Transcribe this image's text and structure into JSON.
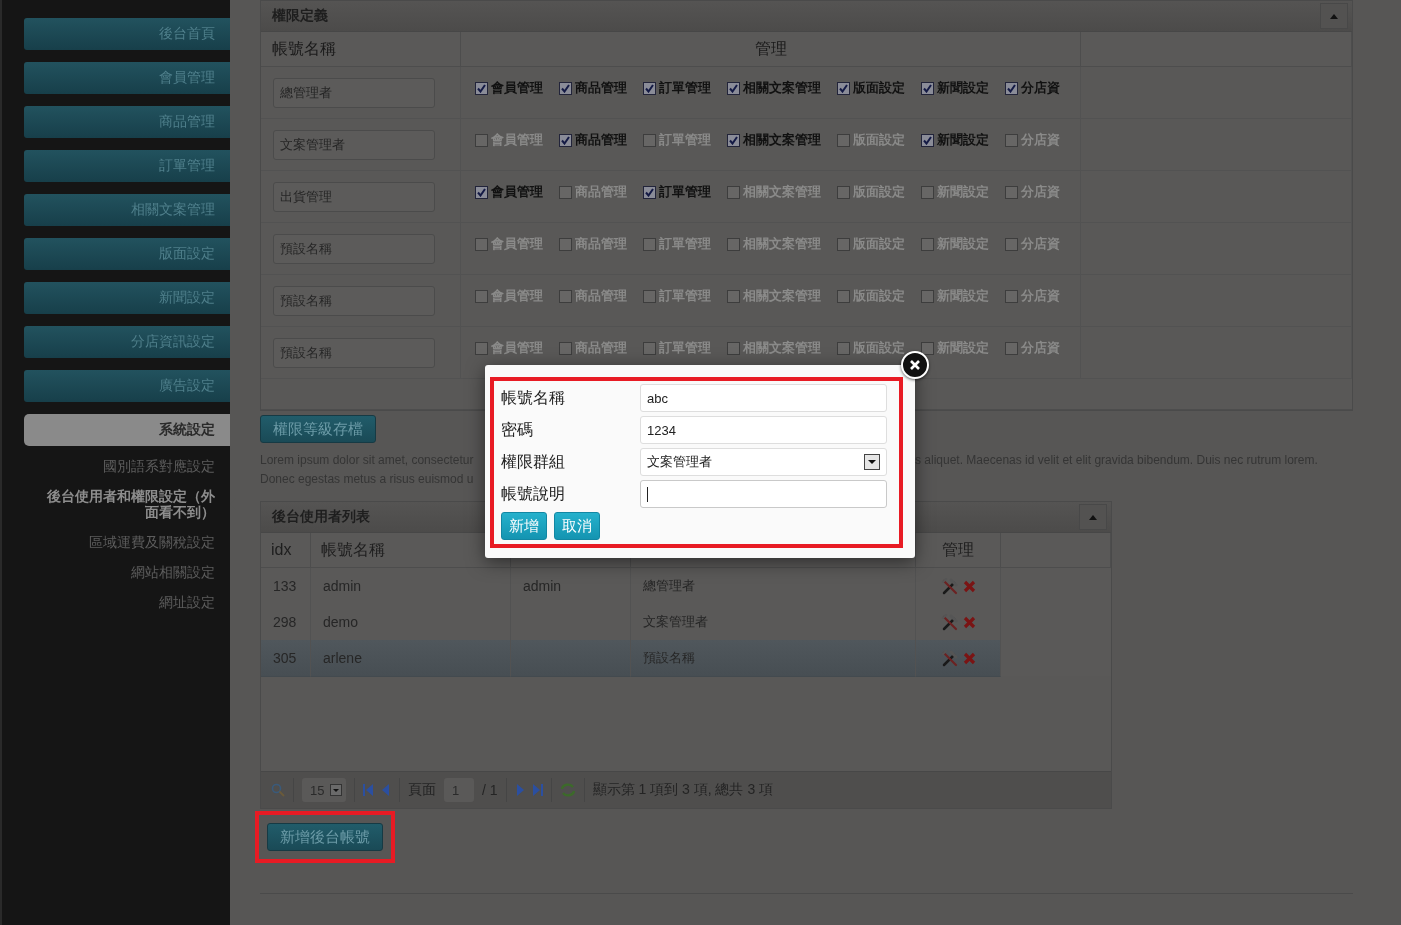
{
  "sidebar": {
    "items": [
      {
        "label": "後台首頁",
        "selected": false
      },
      {
        "label": "會員管理",
        "selected": false
      },
      {
        "label": "商品管理",
        "selected": false
      },
      {
        "label": "訂單管理",
        "selected": false
      },
      {
        "label": "相關文案管理",
        "selected": false
      },
      {
        "label": "版面設定",
        "selected": false
      },
      {
        "label": "新聞設定",
        "selected": false
      },
      {
        "label": "分店資訊設定",
        "selected": false
      },
      {
        "label": "廣告設定",
        "selected": false
      },
      {
        "label": "系統設定",
        "selected": true,
        "children": [
          {
            "label": "國別語系對應設定",
            "selected": false
          },
          {
            "label": "後台使用者和權限設定（外面看不到）",
            "selected": true
          },
          {
            "label": "區域運費及關稅設定",
            "selected": false
          },
          {
            "label": "網站相關設定",
            "selected": false
          },
          {
            "label": "網址設定",
            "selected": false
          }
        ]
      }
    ]
  },
  "permissions": {
    "title": "權限定義",
    "columns": {
      "name": "帳號名稱",
      "manage": "管理"
    },
    "rows": [
      {
        "name": "總管理者",
        "perms": [
          {
            "label": "會員管理",
            "checked": true
          },
          {
            "label": "商品管理",
            "checked": true
          },
          {
            "label": "訂單管理",
            "checked": true
          },
          {
            "label": "相關文案管理",
            "checked": true
          },
          {
            "label": "版面設定",
            "checked": true
          },
          {
            "label": "新聞設定",
            "checked": true
          },
          {
            "label": "分店資",
            "checked": true
          }
        ]
      },
      {
        "name": "文案管理者",
        "perms": [
          {
            "label": "會員管理",
            "checked": false
          },
          {
            "label": "商品管理",
            "checked": true
          },
          {
            "label": "訂單管理",
            "checked": false
          },
          {
            "label": "相關文案管理",
            "checked": true
          },
          {
            "label": "版面設定",
            "checked": false
          },
          {
            "label": "新聞設定",
            "checked": true
          },
          {
            "label": "分店資",
            "checked": false
          }
        ]
      },
      {
        "name": "出貨管理",
        "perms": [
          {
            "label": "會員管理",
            "checked": true
          },
          {
            "label": "商品管理",
            "checked": false
          },
          {
            "label": "訂單管理",
            "checked": true
          },
          {
            "label": "相關文案管理",
            "checked": false
          },
          {
            "label": "版面設定",
            "checked": false
          },
          {
            "label": "新聞設定",
            "checked": false
          },
          {
            "label": "分店資",
            "checked": false
          }
        ]
      },
      {
        "name": "預設名稱",
        "perms": [
          {
            "label": "會員管理",
            "checked": false
          },
          {
            "label": "商品管理",
            "checked": false
          },
          {
            "label": "訂單管理",
            "checked": false
          },
          {
            "label": "相關文案管理",
            "checked": false
          },
          {
            "label": "版面設定",
            "checked": false
          },
          {
            "label": "新聞設定",
            "checked": false
          },
          {
            "label": "分店資",
            "checked": false
          }
        ]
      },
      {
        "name": "預設名稱",
        "perms": [
          {
            "label": "會員管理",
            "checked": false
          },
          {
            "label": "商品管理",
            "checked": false
          },
          {
            "label": "訂單管理",
            "checked": false
          },
          {
            "label": "相關文案管理",
            "checked": false
          },
          {
            "label": "版面設定",
            "checked": false
          },
          {
            "label": "新聞設定",
            "checked": false
          },
          {
            "label": "分店資",
            "checked": false
          }
        ]
      },
      {
        "name": "預設名稱",
        "perms": [
          {
            "label": "會員管理",
            "checked": false
          },
          {
            "label": "商品管理",
            "checked": false
          },
          {
            "label": "訂單管理",
            "checked": false
          },
          {
            "label": "相關文案管理",
            "checked": false
          },
          {
            "label": "版面設定",
            "checked": false
          },
          {
            "label": "新聞設定",
            "checked": false
          },
          {
            "label": "分店資",
            "checked": false
          }
        ]
      }
    ],
    "save_button": "權限等級存檔"
  },
  "description_lines": [
    {
      "left": "Lorem ipsum dolor sit amet, consectetur",
      "right": "s aliquet. Maecenas id velit et elit gravida bibendum. Duis nec rutrum lorem."
    },
    {
      "left": "Donec egestas metus a risus euismod u"
    }
  ],
  "users": {
    "title": "後台使用者列表",
    "header": {
      "idx": "idx",
      "account": "帳號名稱",
      "manage": "管理"
    },
    "rows": [
      {
        "idx": "133",
        "account": "admin",
        "column_3": "admin",
        "column_4": "總管理者",
        "selected": false
      },
      {
        "idx": "298",
        "account": "demo",
        "column_4": "文案管理者",
        "selected": false
      },
      {
        "idx": "305",
        "account": "arlene",
        "column_4": "預設名稱",
        "selected": true
      }
    ],
    "pager": {
      "page_size": "15",
      "page_label": "頁面",
      "page": "1",
      "page_total": "/ 1",
      "summary": "顯示第 1 項到 3 項, 總共 3 項"
    },
    "add_button": {
      "label": "新增後台帳號",
      "annotated": true
    }
  },
  "dialog": {
    "annotated": true,
    "fields": [
      {
        "kind": "text",
        "label": "帳號名稱",
        "value": "abc",
        "focused": false
      },
      {
        "kind": "text",
        "label": "密碼",
        "value": "1234",
        "focused": false
      },
      {
        "kind": "select",
        "label": "權限群組",
        "value": "文案管理者",
        "focused": false
      },
      {
        "kind": "text",
        "label": "帳號說明",
        "focused": true
      }
    ],
    "buttons": [
      "新增",
      "取消"
    ]
  }
}
